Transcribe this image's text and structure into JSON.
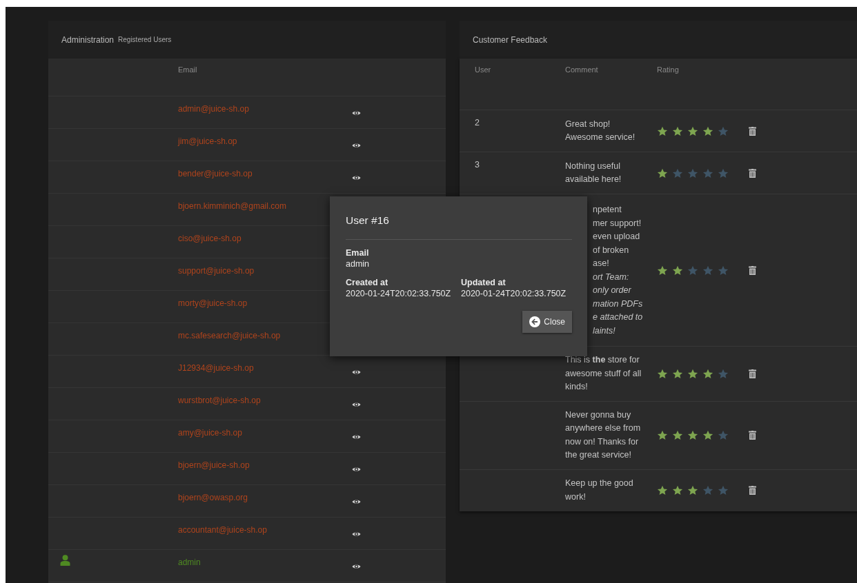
{
  "admin_panel": {
    "title": "Administration",
    "subtitle": "Registered Users",
    "columns": [
      "Email"
    ],
    "users": [
      {
        "email": "admin@juice-sh.op",
        "view_icon": true,
        "current": false
      },
      {
        "email": "jim@juice-sh.op",
        "view_icon": true,
        "current": false
      },
      {
        "email": "bender@juice-sh.op",
        "view_icon": true,
        "current": false
      },
      {
        "email": "bjoern.kimminich@gmail.com",
        "view_icon": false,
        "current": false
      },
      {
        "email": "ciso@juice-sh.op",
        "view_icon": false,
        "current": false
      },
      {
        "email": "support@juice-sh.op",
        "view_icon": false,
        "current": false
      },
      {
        "email": "morty@juice-sh.op",
        "view_icon": false,
        "current": false
      },
      {
        "email": "mc.safesearch@juice-sh.op",
        "view_icon": false,
        "current": false
      },
      {
        "email": "J12934@juice-sh.op",
        "view_icon": true,
        "current": false
      },
      {
        "email": "wurstbrot@juice-sh.op",
        "view_icon": true,
        "current": false
      },
      {
        "email": "amy@juice-sh.op",
        "view_icon": true,
        "current": false
      },
      {
        "email": "bjoern@juice-sh.op",
        "view_icon": true,
        "current": false
      },
      {
        "email": "bjoern@owasp.org",
        "view_icon": true,
        "current": false
      },
      {
        "email": "accountant@juice-sh.op",
        "view_icon": true,
        "current": false
      },
      {
        "email": "admin",
        "view_icon": true,
        "current": true
      }
    ]
  },
  "feedback_panel": {
    "title": "Customer Feedback",
    "columns": [
      "User",
      "Comment",
      "Rating"
    ],
    "rows": [
      {
        "kind": "full",
        "user": "2",
        "comment": "Great shop! Awesome service!",
        "stars": 4
      },
      {
        "kind": "full",
        "user": "3",
        "comment": "Nothing useful available here!",
        "stars": 1
      },
      {
        "kind": "covered",
        "comment_lines": [
          {
            "text": "npetent",
            "italic": false
          },
          {
            "text": "mer support!",
            "italic": false
          },
          {
            "text": "even upload",
            "italic": false
          },
          {
            "text": "of broken",
            "italic": false
          },
          {
            "text": "ase!",
            "italic": false
          },
          {
            "text": "ort Team:",
            "italic": true
          },
          {
            "text": "only order",
            "italic": true
          },
          {
            "text": "mation PDFs",
            "italic": true
          },
          {
            "text": "e attached to",
            "italic": true
          },
          {
            "text": "laints!",
            "italic": true
          }
        ],
        "stars": 2
      },
      {
        "kind": "full",
        "comment": "This is **the** store for awesome stuff of all kinds!",
        "stars": 4
      },
      {
        "kind": "full",
        "comment": "Never gonna buy anywhere else from now on! Thanks for the great service!",
        "stars": 4
      },
      {
        "kind": "full",
        "comment": "Keep up the good work!",
        "stars": 3
      }
    ]
  },
  "user_dialog": {
    "title": "User #16",
    "fields": [
      {
        "label": "Email",
        "value": "admin"
      },
      {
        "label": "Created at",
        "value": "2020-01-24T20:02:33.750Z"
      },
      {
        "label": "Updated at",
        "value": "2020-01-24T20:02:33.750Z"
      }
    ],
    "close_button": "Close"
  }
}
